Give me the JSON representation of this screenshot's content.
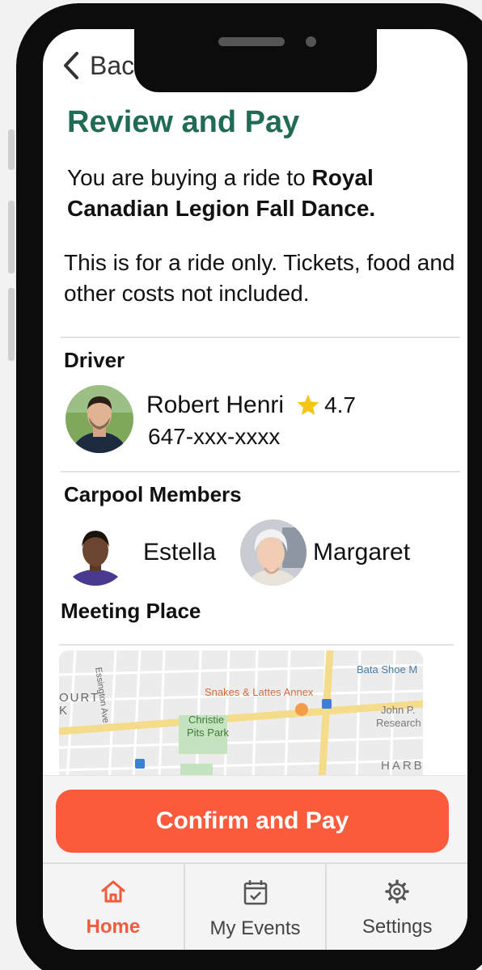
{
  "header": {
    "back_label": "Back"
  },
  "page_title": "Review and Pay",
  "purchase": {
    "prefix": "You are buying a ride to ",
    "event_name": "Royal Canadian Legion Fall Dance."
  },
  "disclaimer": "This is for a ride only. Tickets, food and other costs not included.",
  "driver": {
    "heading": "Driver",
    "name": "Robert Henri",
    "rating": "4.7",
    "phone": "647-xxx-xxxx"
  },
  "carpool": {
    "heading": "Carpool Members",
    "members": [
      {
        "name": "Estella"
      },
      {
        "name": "Margaret"
      }
    ]
  },
  "meeting": {
    "heading": "Meeting Place",
    "map_labels": {
      "street": "Essington Ave",
      "court": "OURT",
      "court2": "K",
      "cafe": "Snakes & Lattes Annex",
      "park1": "Christie",
      "park2": "Pits Park",
      "museum": "Bata Shoe M",
      "research1": "John P.",
      "research2": "Research",
      "harbour": "HARB"
    }
  },
  "actions": {
    "confirm_label": "Confirm and Pay"
  },
  "tabs": [
    {
      "label": "Home",
      "icon": "home-icon",
      "active": true
    },
    {
      "label": "My Events",
      "icon": "calendar-check-icon",
      "active": false
    },
    {
      "label": "Settings",
      "icon": "gear-icon",
      "active": false
    }
  ],
  "colors": {
    "title": "#1f6b56",
    "accent": "#fa5b3c",
    "star": "#f5c518"
  }
}
